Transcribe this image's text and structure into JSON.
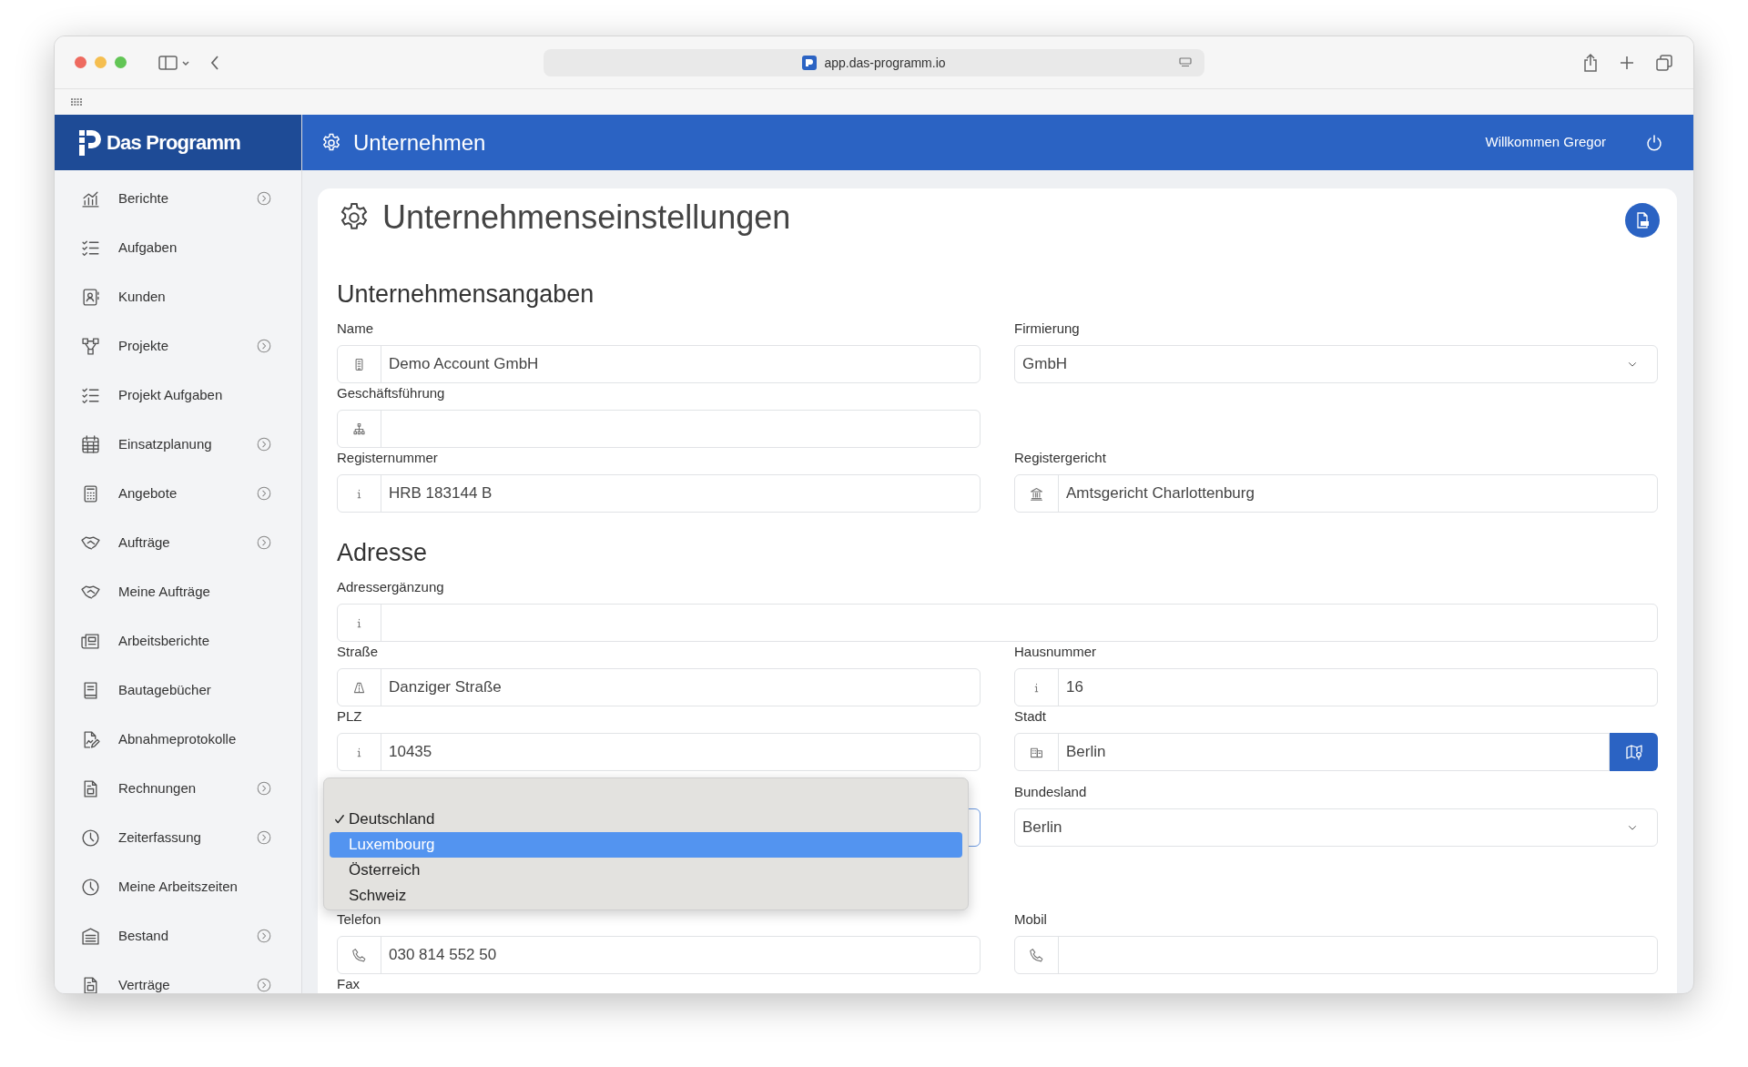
{
  "browser": {
    "url": "app.das-programm.io"
  },
  "app": {
    "logo": "Das Programm",
    "page_title": "Unternehmen",
    "welcome": "Willkommen Gregor"
  },
  "sidebar": {
    "items": [
      {
        "label": "Berichte",
        "submenu": true
      },
      {
        "label": "Aufgaben",
        "submenu": false
      },
      {
        "label": "Kunden",
        "submenu": false
      },
      {
        "label": "Projekte",
        "submenu": true
      },
      {
        "label": "Projekt Aufgaben",
        "submenu": false
      },
      {
        "label": "Einsatzplanung",
        "submenu": true
      },
      {
        "label": "Angebote",
        "submenu": true
      },
      {
        "label": "Aufträge",
        "submenu": true
      },
      {
        "label": "Meine Aufträge",
        "submenu": false
      },
      {
        "label": "Arbeitsberichte",
        "submenu": false
      },
      {
        "label": "Bautagebücher",
        "submenu": false
      },
      {
        "label": "Abnahmeprotokolle",
        "submenu": false
      },
      {
        "label": "Rechnungen",
        "submenu": true
      },
      {
        "label": "Zeiterfassung",
        "submenu": true
      },
      {
        "label": "Meine Arbeitszeiten",
        "submenu": false
      },
      {
        "label": "Bestand",
        "submenu": true
      },
      {
        "label": "Verträge",
        "submenu": true
      }
    ]
  },
  "card": {
    "title": "Unternehmenseinstellungen",
    "sections": [
      {
        "title": "Unternehmensangaben",
        "rows": [
          [
            {
              "label": "Name",
              "kind": "input",
              "value": "Demo Account GmbH"
            },
            {
              "label": "Firmierung",
              "kind": "select",
              "value": "GmbH"
            }
          ],
          [
            {
              "label": "Geschäftsführung",
              "kind": "input"
            }
          ],
          [
            {
              "label": "Registernummer",
              "kind": "input",
              "value": "HRB 183144 B"
            },
            {
              "label": "Registergericht",
              "kind": "input",
              "value": "Amtsgericht Charlottenburg"
            }
          ]
        ]
      },
      {
        "title": "Adresse",
        "rows": [
          [
            {
              "label": "Adressergänzung",
              "kind": "input"
            }
          ],
          [
            {
              "label": "Straße",
              "kind": "input",
              "value": "Danziger Straße"
            },
            {
              "label": "Hausnummer",
              "kind": "input",
              "value": "16"
            }
          ],
          [
            {
              "label": "PLZ",
              "kind": "input",
              "value": "10435"
            },
            {
              "label": "Stadt",
              "kind": "input",
              "value": "Berlin"
            }
          ],
          [
            {
              "kind": "select",
              "focused": true,
              "popup": {
                "options": [
                  {
                    "label": "Deutschland",
                    "checked": true,
                    "selected": false
                  },
                  {
                    "label": "Luxembourg",
                    "checked": false,
                    "selected": true
                  },
                  {
                    "label": "Österreich",
                    "checked": false,
                    "selected": false
                  },
                  {
                    "label": "Schweiz",
                    "checked": false,
                    "selected": false
                  }
                ]
              }
            },
            {
              "label": "Bundesland",
              "kind": "select",
              "value": "Berlin"
            }
          ],
          [
            {
              "label": "Telefon",
              "kind": "input",
              "value": "030 814 552 50"
            },
            {
              "label": "Mobil",
              "kind": "input"
            }
          ],
          [
            {
              "label": "Fax",
              "kind": "label"
            }
          ]
        ]
      }
    ]
  }
}
